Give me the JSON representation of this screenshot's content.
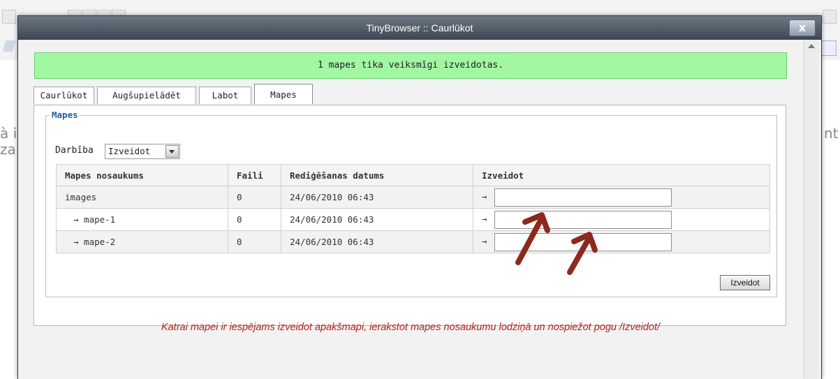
{
  "background": {
    "left_fragment_1": "à i",
    "left_fragment_2": "za",
    "right_fragment": "nt"
  },
  "dialog": {
    "title": "TinyBrowser :: Caurlūkot",
    "close_label": "x"
  },
  "success_message": "1 mapes tika veiksmīgi izveidotas.",
  "tabs": [
    {
      "label": "Caurlūkot",
      "active": false
    },
    {
      "label": "Augšupielādēt",
      "active": false
    },
    {
      "label": "Labot",
      "active": false
    },
    {
      "label": "Mapes",
      "active": true
    }
  ],
  "fieldset_legend": "Mapes",
  "action": {
    "label": "Darbība",
    "selected": "Izveidot"
  },
  "table": {
    "headers": [
      "Mapes nosaukums",
      "Faili",
      "Rediģēšanas datums",
      "Izveidot"
    ],
    "rows": [
      {
        "name": "images",
        "files": "0",
        "date": "24/06/2010 06:43",
        "arrow": "→",
        "input_value": ""
      },
      {
        "name": "→ mape-1",
        "files": "0",
        "date": "24/06/2010 06:43",
        "arrow": "→",
        "input_value": ""
      },
      {
        "name": "→ mape-2",
        "files": "0",
        "date": "24/06/2010 06:43",
        "arrow": "→",
        "input_value": ""
      }
    ]
  },
  "submit_label": "Izveidot",
  "note": "Katrai mapei ir iespējams izveidot apakšmapi, ierakstot mapes nosaukumu lodziņā un nospiežot pogu /Izveidot/",
  "colors": {
    "success_bg": "#a2f7a3",
    "legend": "#1f5fa0",
    "note": "#b5261e",
    "annotation_arrow": "#8b2a1c"
  }
}
